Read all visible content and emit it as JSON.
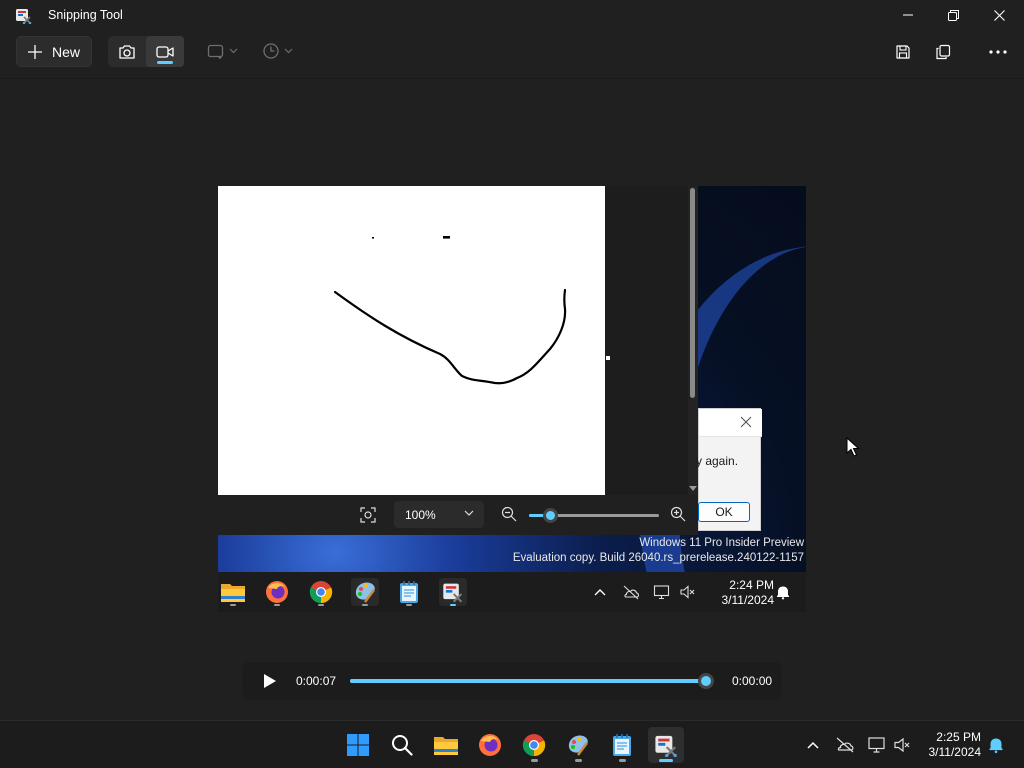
{
  "window": {
    "title": "Snipping Tool"
  },
  "toolbar": {
    "new_label": "New",
    "modes": [
      "screenshot-mode",
      "record-mode"
    ],
    "active_mode": "record-mode"
  },
  "capture": {
    "paint_zoom": "100%",
    "dialog_message": "y again.",
    "dialog_ok": "OK",
    "watermark_line1": "Windows 11 Pro Insider Preview",
    "watermark_line2": "Evaluation copy. Build 26040.rs_prerelease.240122-1157",
    "inner_time": "2:24 PM",
    "inner_date": "3/11/2024"
  },
  "player": {
    "current_time": "0:00:07",
    "end_time": "0:00:00",
    "progress": 0.98
  },
  "taskbar": {
    "time": "2:25 PM",
    "date": "3/11/2024",
    "apps": [
      "start",
      "search",
      "file-explorer",
      "firefox",
      "chrome",
      "paint",
      "notepad",
      "snipping-tool"
    ],
    "active_app": "snipping-tool"
  },
  "colors": {
    "accent": "#60cdff",
    "background": "#202020",
    "taskbar": "#1c1c1c"
  }
}
